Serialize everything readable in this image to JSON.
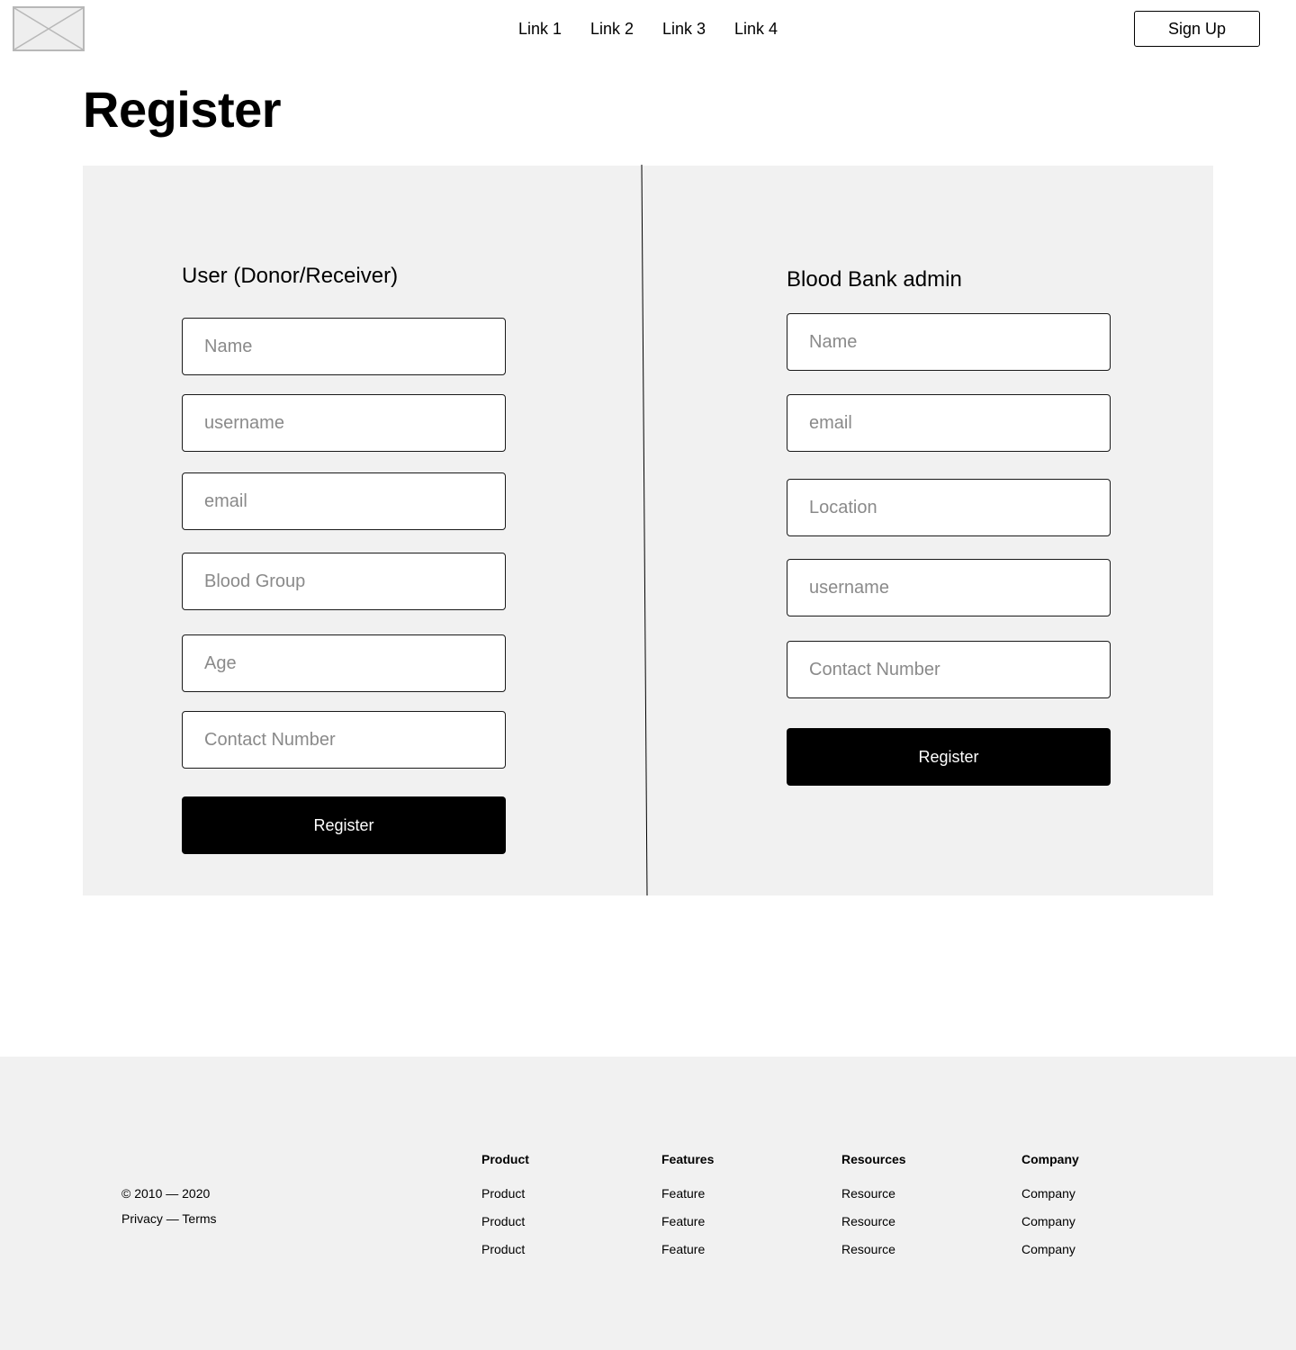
{
  "header": {
    "logo_icon": "image-placeholder-icon",
    "nav": [
      "Link 1",
      "Link 2",
      "Link 3",
      "Link 4"
    ],
    "signup_label": "Sign Up"
  },
  "page_title": "Register",
  "user_form": {
    "title": "User (Donor/Receiver)",
    "fields": [
      "Name",
      "username",
      "email",
      "Blood Group",
      "Age",
      "Contact Number"
    ],
    "submit_label": "Register"
  },
  "admin_form": {
    "title": "Blood Bank admin",
    "fields": [
      "Name",
      "email",
      "Location",
      "username",
      "Contact Number"
    ],
    "submit_label": "Register"
  },
  "footer": {
    "copyright": "© 2010 — 2020",
    "legal": "Privacy — Terms",
    "columns": [
      {
        "heading": "Product",
        "items": [
          "Product",
          "Product",
          "Product"
        ]
      },
      {
        "heading": "Features",
        "items": [
          "Feature",
          "Feature",
          "Feature"
        ]
      },
      {
        "heading": "Resources",
        "items": [
          "Resource",
          "Resource",
          "Resource"
        ]
      },
      {
        "heading": "Company",
        "items": [
          "Company",
          "Company",
          "Company"
        ]
      }
    ]
  },
  "colors": {
    "panel_bg": "#f1f1f1",
    "button_bg": "#000000",
    "button_text": "#ffffff",
    "placeholder": "#8a8a8a"
  }
}
